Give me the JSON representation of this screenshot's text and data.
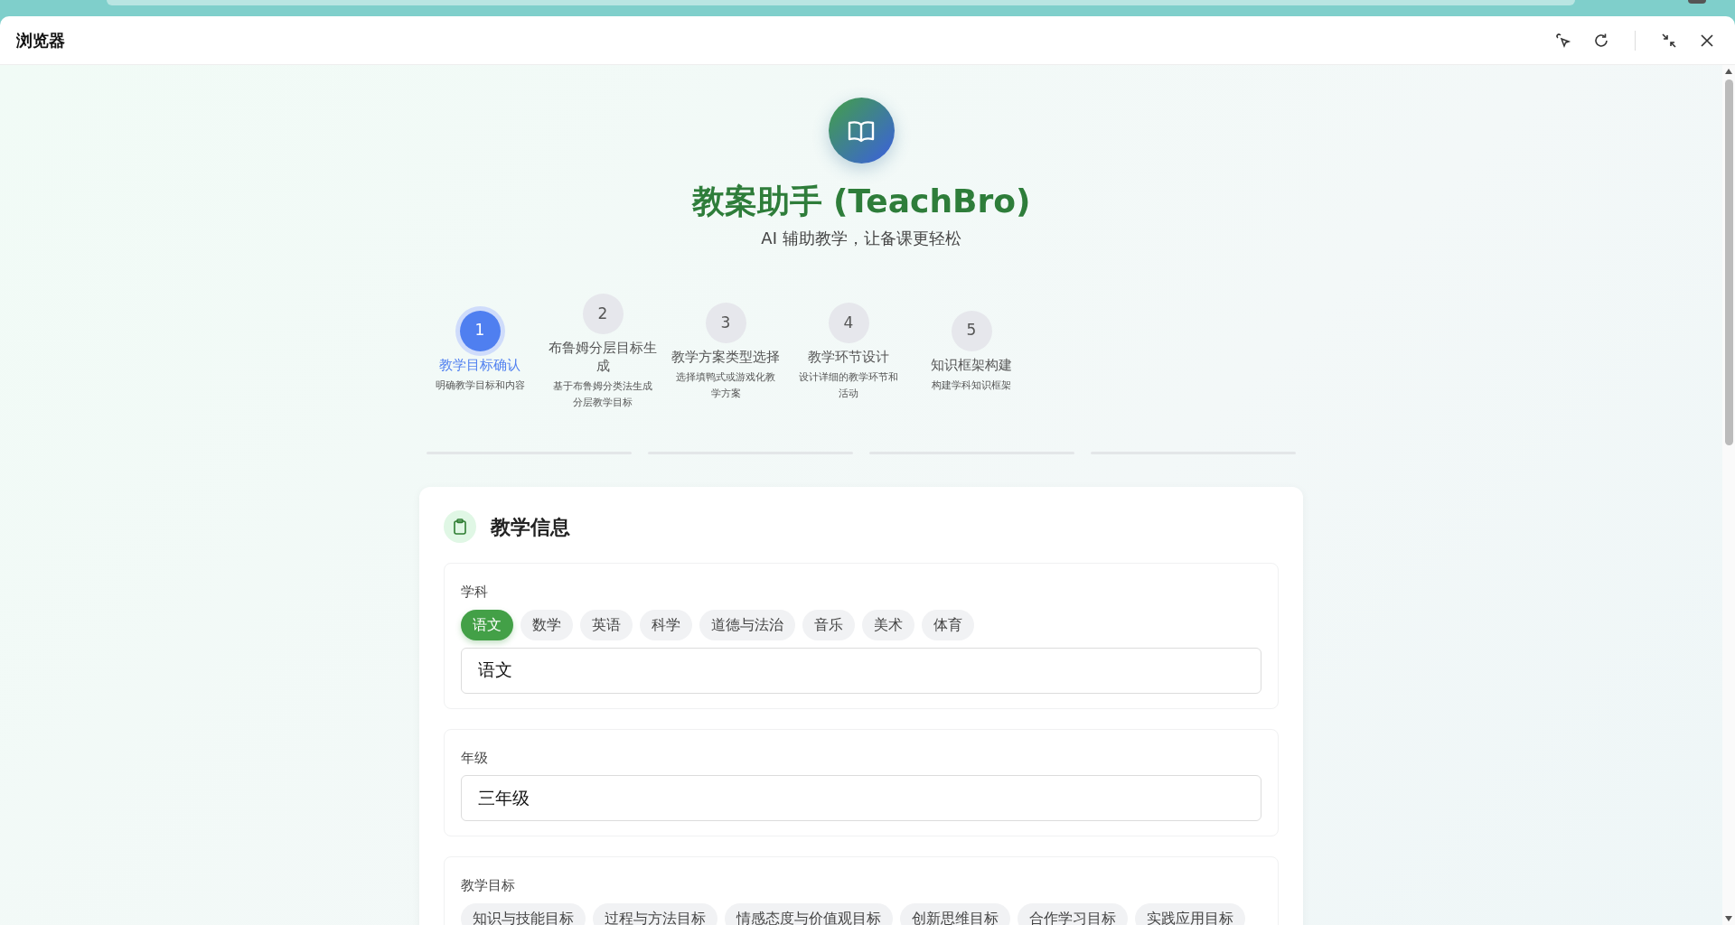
{
  "window": {
    "title": "浏览器"
  },
  "header": {
    "title": "教案助手 (TeachBro)",
    "subtitle": "AI 辅助教学，让备课更轻松"
  },
  "steps": [
    {
      "number": "1",
      "title": "教学目标确认",
      "description": "明确教学目标和内容",
      "selected": true
    },
    {
      "number": "2",
      "title": "布鲁姆分层目标生成",
      "description": "基于布鲁姆分类法生成分层教学目标",
      "selected": false
    },
    {
      "number": "3",
      "title": "教学方案类型选择",
      "description": "选择填鸭式或游戏化教学方案",
      "selected": false
    },
    {
      "number": "4",
      "title": "教学环节设计",
      "description": "设计详细的教学环节和活动",
      "selected": false
    },
    {
      "number": "5",
      "title": "知识框架构建",
      "description": "构建学科知识框架",
      "selected": false
    }
  ],
  "card": {
    "title": "教学信息",
    "sections": [
      {
        "label": "学科",
        "options": [
          {
            "label": "语文",
            "selected": true
          },
          {
            "label": "数学",
            "selected": false
          },
          {
            "label": "英语",
            "selected": false
          },
          {
            "label": "科学",
            "selected": false
          },
          {
            "label": "道德与法治",
            "selected": false
          },
          {
            "label": "音乐",
            "selected": false
          },
          {
            "label": "美术",
            "selected": false
          },
          {
            "label": "体育",
            "selected": false
          }
        ],
        "value": "语文"
      },
      {
        "label": "年级",
        "value": "三年级"
      },
      {
        "label": "教学目标",
        "options": [
          {
            "label": "知识与技能目标",
            "selected": false
          },
          {
            "label": "过程与方法目标",
            "selected": false
          },
          {
            "label": "情感态度与价值观目标",
            "selected": false
          },
          {
            "label": "创新思维目标",
            "selected": false
          },
          {
            "label": "合作学习目标",
            "selected": false
          },
          {
            "label": "实践应用目标",
            "selected": false
          }
        ]
      }
    ]
  }
}
